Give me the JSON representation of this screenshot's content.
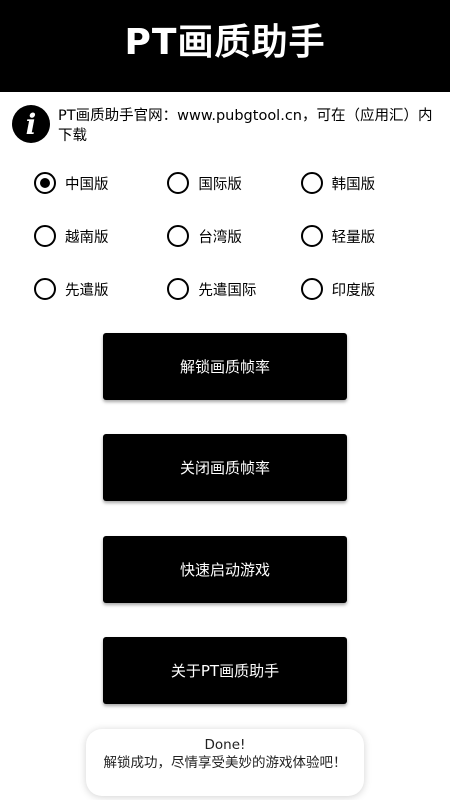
{
  "header": {
    "title": "PT画质助手"
  },
  "info": {
    "icon": "info-icon",
    "glyph": "i",
    "text": "PT画质助手官网：www.pubgtool.cn，可在（应用汇）内下载"
  },
  "versions": [
    [
      {
        "label": "中国版",
        "selected": true
      },
      {
        "label": "国际版",
        "selected": false
      },
      {
        "label": "韩国版",
        "selected": false
      }
    ],
    [
      {
        "label": "越南版",
        "selected": false
      },
      {
        "label": "台湾版",
        "selected": false
      },
      {
        "label": "轻量版",
        "selected": false
      }
    ],
    [
      {
        "label": "先遣版",
        "selected": false
      },
      {
        "label": "先遣国际",
        "selected": false
      },
      {
        "label": "印度版",
        "selected": false
      }
    ]
  ],
  "buttons": {
    "unlock": "解锁画质帧率",
    "close": "关闭画质帧率",
    "launch": "快速启动游戏",
    "about": "关于PT画质助手"
  },
  "toast": {
    "title": "Done!",
    "message": "解锁成功，尽情享受美妙的游戏体验吧！"
  },
  "colors": {
    "primary": "#000000",
    "background": "#ffffff",
    "button_text": "#ffffff"
  }
}
